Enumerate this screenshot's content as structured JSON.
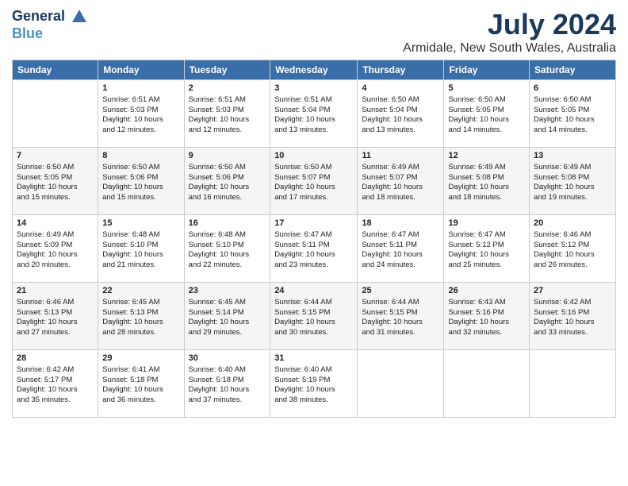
{
  "logo": {
    "line1": "General",
    "line2": "Blue"
  },
  "title": "July 2024",
  "location": "Armidale, New South Wales, Australia",
  "days_of_week": [
    "Sunday",
    "Monday",
    "Tuesday",
    "Wednesday",
    "Thursday",
    "Friday",
    "Saturday"
  ],
  "weeks": [
    [
      {
        "day": "",
        "content": ""
      },
      {
        "day": "1",
        "content": "Sunrise: 6:51 AM\nSunset: 5:03 PM\nDaylight: 10 hours\nand 12 minutes."
      },
      {
        "day": "2",
        "content": "Sunrise: 6:51 AM\nSunset: 5:03 PM\nDaylight: 10 hours\nand 12 minutes."
      },
      {
        "day": "3",
        "content": "Sunrise: 6:51 AM\nSunset: 5:04 PM\nDaylight: 10 hours\nand 13 minutes."
      },
      {
        "day": "4",
        "content": "Sunrise: 6:50 AM\nSunset: 5:04 PM\nDaylight: 10 hours\nand 13 minutes."
      },
      {
        "day": "5",
        "content": "Sunrise: 6:50 AM\nSunset: 5:05 PM\nDaylight: 10 hours\nand 14 minutes."
      },
      {
        "day": "6",
        "content": "Sunrise: 6:50 AM\nSunset: 5:05 PM\nDaylight: 10 hours\nand 14 minutes."
      }
    ],
    [
      {
        "day": "7",
        "content": "Sunrise: 6:50 AM\nSunset: 5:05 PM\nDaylight: 10 hours\nand 15 minutes."
      },
      {
        "day": "8",
        "content": "Sunrise: 6:50 AM\nSunset: 5:06 PM\nDaylight: 10 hours\nand 15 minutes."
      },
      {
        "day": "9",
        "content": "Sunrise: 6:50 AM\nSunset: 5:06 PM\nDaylight: 10 hours\nand 16 minutes."
      },
      {
        "day": "10",
        "content": "Sunrise: 6:50 AM\nSunset: 5:07 PM\nDaylight: 10 hours\nand 17 minutes."
      },
      {
        "day": "11",
        "content": "Sunrise: 6:49 AM\nSunset: 5:07 PM\nDaylight: 10 hours\nand 18 minutes."
      },
      {
        "day": "12",
        "content": "Sunrise: 6:49 AM\nSunset: 5:08 PM\nDaylight: 10 hours\nand 18 minutes."
      },
      {
        "day": "13",
        "content": "Sunrise: 6:49 AM\nSunset: 5:08 PM\nDaylight: 10 hours\nand 19 minutes."
      }
    ],
    [
      {
        "day": "14",
        "content": "Sunrise: 6:49 AM\nSunset: 5:09 PM\nDaylight: 10 hours\nand 20 minutes."
      },
      {
        "day": "15",
        "content": "Sunrise: 6:48 AM\nSunset: 5:10 PM\nDaylight: 10 hours\nand 21 minutes."
      },
      {
        "day": "16",
        "content": "Sunrise: 6:48 AM\nSunset: 5:10 PM\nDaylight: 10 hours\nand 22 minutes."
      },
      {
        "day": "17",
        "content": "Sunrise: 6:47 AM\nSunset: 5:11 PM\nDaylight: 10 hours\nand 23 minutes."
      },
      {
        "day": "18",
        "content": "Sunrise: 6:47 AM\nSunset: 5:11 PM\nDaylight: 10 hours\nand 24 minutes."
      },
      {
        "day": "19",
        "content": "Sunrise: 6:47 AM\nSunset: 5:12 PM\nDaylight: 10 hours\nand 25 minutes."
      },
      {
        "day": "20",
        "content": "Sunrise: 6:46 AM\nSunset: 5:12 PM\nDaylight: 10 hours\nand 26 minutes."
      }
    ],
    [
      {
        "day": "21",
        "content": "Sunrise: 6:46 AM\nSunset: 5:13 PM\nDaylight: 10 hours\nand 27 minutes."
      },
      {
        "day": "22",
        "content": "Sunrise: 6:45 AM\nSunset: 5:13 PM\nDaylight: 10 hours\nand 28 minutes."
      },
      {
        "day": "23",
        "content": "Sunrise: 6:45 AM\nSunset: 5:14 PM\nDaylight: 10 hours\nand 29 minutes."
      },
      {
        "day": "24",
        "content": "Sunrise: 6:44 AM\nSunset: 5:15 PM\nDaylight: 10 hours\nand 30 minutes."
      },
      {
        "day": "25",
        "content": "Sunrise: 6:44 AM\nSunset: 5:15 PM\nDaylight: 10 hours\nand 31 minutes."
      },
      {
        "day": "26",
        "content": "Sunrise: 6:43 AM\nSunset: 5:16 PM\nDaylight: 10 hours\nand 32 minutes."
      },
      {
        "day": "27",
        "content": "Sunrise: 6:42 AM\nSunset: 5:16 PM\nDaylight: 10 hours\nand 33 minutes."
      }
    ],
    [
      {
        "day": "28",
        "content": "Sunrise: 6:42 AM\nSunset: 5:17 PM\nDaylight: 10 hours\nand 35 minutes."
      },
      {
        "day": "29",
        "content": "Sunrise: 6:41 AM\nSunset: 5:18 PM\nDaylight: 10 hours\nand 36 minutes."
      },
      {
        "day": "30",
        "content": "Sunrise: 6:40 AM\nSunset: 5:18 PM\nDaylight: 10 hours\nand 37 minutes."
      },
      {
        "day": "31",
        "content": "Sunrise: 6:40 AM\nSunset: 5:19 PM\nDaylight: 10 hours\nand 38 minutes."
      },
      {
        "day": "",
        "content": ""
      },
      {
        "day": "",
        "content": ""
      },
      {
        "day": "",
        "content": ""
      }
    ]
  ]
}
